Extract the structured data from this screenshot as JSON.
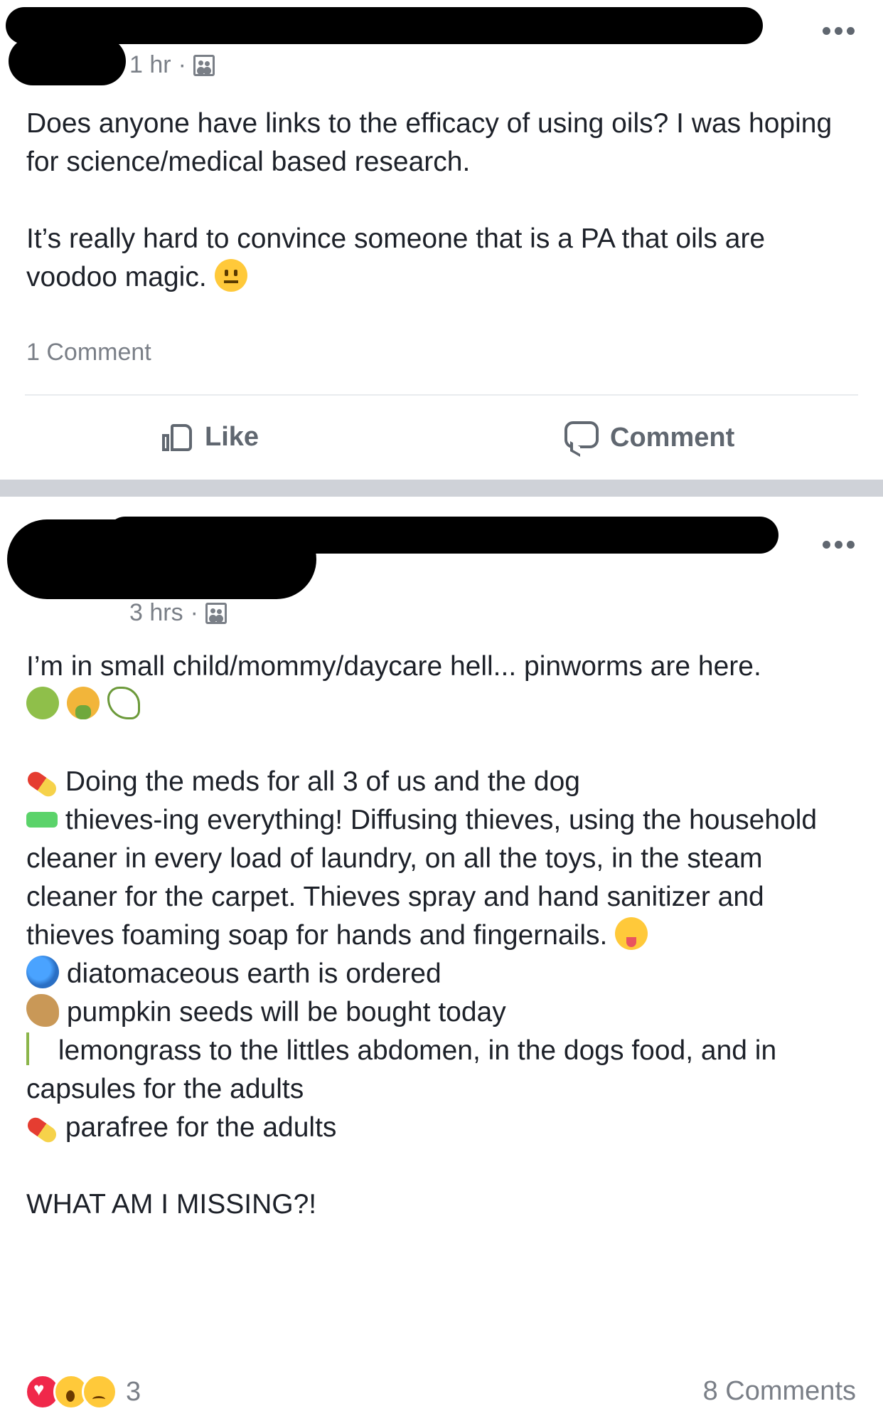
{
  "post1": {
    "meta_time": "1 hr",
    "meta_separator": "·",
    "paragraph1": "Does anyone have links to the efficacy of using oils? I was hoping for science/medical based research.",
    "paragraph2": "It’s really hard to convince someone that is a PA that oils are voodoo magic.",
    "comment_count": "1 Comment",
    "like_label": "Like",
    "comment_label": "Comment"
  },
  "post2": {
    "meta_time": "3 hrs",
    "meta_separator": "·",
    "intro": "I’m in small child/mommy/daycare hell... pinworms are here.",
    "items": [
      "Doing the meds for all 3 of us and the dog",
      "thieves-ing everything! Diffusing thieves, using the household cleaner in every load of laundry, on all the toys, in the steam cleaner for the carpet. Thieves spray and hand sanitizer and thieves foaming soap for hands and fingernails.",
      "diatomaceous earth is ordered",
      "pumpkin seeds will be bought today",
      "lemongrass to the littles abdomen, in the dogs food, and in capsules for the adults",
      "parafree for the adults"
    ],
    "closing": "WHAT AM I MISSING?!",
    "reaction_count": "3",
    "comment_count": "8 Comments"
  }
}
